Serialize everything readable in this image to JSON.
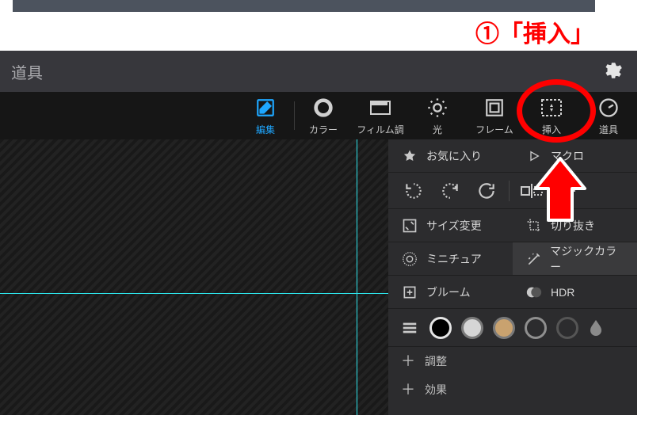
{
  "annotation": {
    "text": "①「挿入」"
  },
  "header": {
    "title": "道具"
  },
  "toolbar": {
    "edit": "編集",
    "color": "カラー",
    "film": "フィルム調",
    "light": "光",
    "frame": "フレーム",
    "insert": "挿入",
    "tools": "道具"
  },
  "panel": {
    "favorites": "お気に入り",
    "macro": "マクロ",
    "resize": "サイズ変更",
    "crop": "切り抜き",
    "miniature": "ミニチュア",
    "magic_color": "マジックカラー",
    "bloom": "ブルーム",
    "hdr": "HDR",
    "adjust": "調整",
    "effect": "効果"
  },
  "swatches": [
    "#000000",
    "#d6d6d6",
    "#c9a26f",
    "#8f8f8f",
    "#555555"
  ]
}
